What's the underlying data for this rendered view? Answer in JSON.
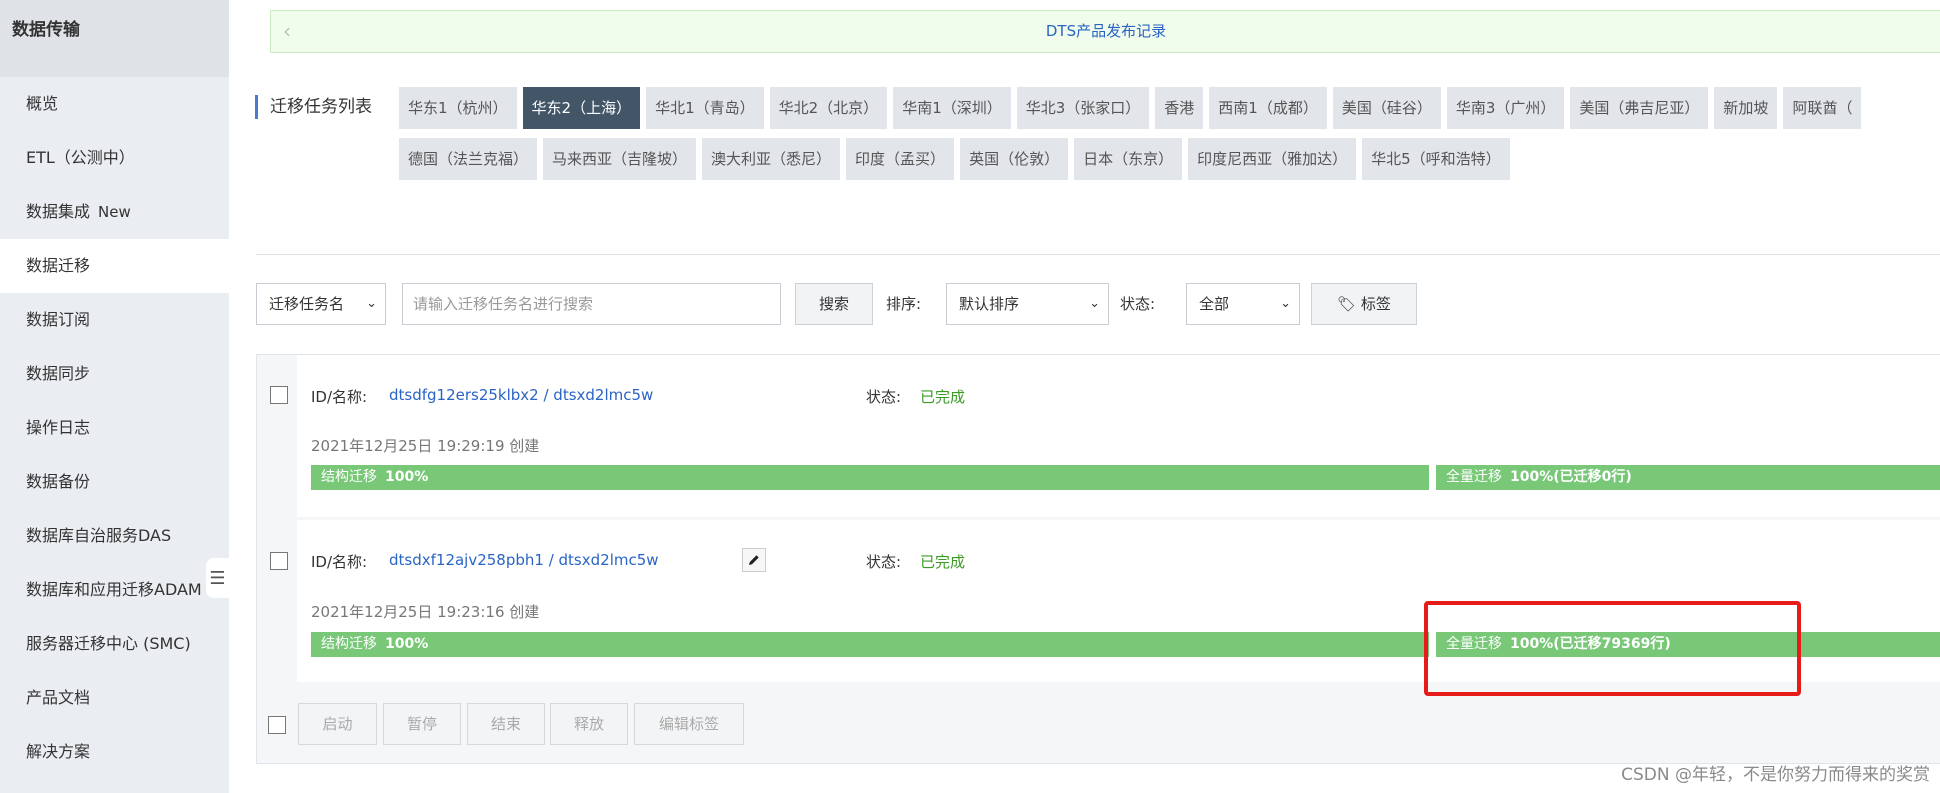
{
  "sidebar": {
    "title": "数据传输",
    "items": [
      {
        "label": "概览"
      },
      {
        "label": "ETL（公测中）"
      },
      {
        "label": "数据集成",
        "badge": "New"
      },
      {
        "label": "数据迁移"
      },
      {
        "label": "数据订阅"
      },
      {
        "label": "数据同步"
      },
      {
        "label": "操作日志"
      },
      {
        "label": "数据备份"
      },
      {
        "label": "数据库自治服务DAS"
      },
      {
        "label": "数据库和应用迁移ADAM"
      },
      {
        "label": "服务器迁移中心 (SMC)"
      },
      {
        "label": "产品文档"
      },
      {
        "label": "解决方案"
      }
    ],
    "active_item": "数据迁移"
  },
  "banner": {
    "text": "DTS产品发布记录"
  },
  "task_list": {
    "title": "迁移任务列表",
    "regions_row1": [
      "华东1（杭州）",
      "华东2（上海）",
      "华北1（青岛）",
      "华北2（北京）",
      "华南1（深圳）",
      "华北3（张家口）",
      "香港",
      "西南1（成都）",
      "美国（硅谷）",
      "华南3（广州）",
      "美国（弗吉尼亚）",
      "新加坡",
      "阿联酋（"
    ],
    "regions_row2": [
      "德国（法兰克福）",
      "马来西亚（吉隆坡）",
      "澳大利亚（悉尼）",
      "印度（孟买）",
      "英国（伦敦）",
      "日本（东京）",
      "印度尼西亚（雅加达）",
      "华北5（呼和浩特）"
    ],
    "active_region": "华东2（上海）"
  },
  "toolbar": {
    "filter_select": "迁移任务名",
    "search_placeholder": "请输入迁移任务名进行搜索",
    "search_button": "搜索",
    "sort_label": "排序:",
    "sort_value": "默认排序",
    "status_label": "状态:",
    "status_value": "全部",
    "tag_button": "标签"
  },
  "tasks": [
    {
      "id_label": "ID/名称:",
      "name": "dtsdfg12ers25klbx2 / dtsxd2lmc5w",
      "status_label": "状态:",
      "status": "已完成",
      "created": "2021年12月25日 19:29:19  创建",
      "schema_label": "结构迁移",
      "schema_pct": "100%",
      "full_label": "全量迁移",
      "full_pct": "100%(已迁移0行)"
    },
    {
      "id_label": "ID/名称:",
      "name": "dtsdxf12ajv258pbh1 / dtsxd2lmc5w",
      "status_label": "状态:",
      "status": "已完成",
      "created": "2021年12月25日 19:23:16  创建",
      "schema_label": "结构迁移",
      "schema_pct": "100%",
      "full_label": "全量迁移",
      "full_pct": "100%(已迁移79369行)"
    }
  ],
  "actions": [
    "启动",
    "暂停",
    "结束",
    "释放",
    "编辑标签"
  ],
  "watermark": "CSDN @年轻，不是你努力而得来的奖赏",
  "colors": {
    "accent": "#2a64c5",
    "success": "#3a9b25",
    "bar": "#78c878",
    "highlight": "#e81b1b"
  }
}
